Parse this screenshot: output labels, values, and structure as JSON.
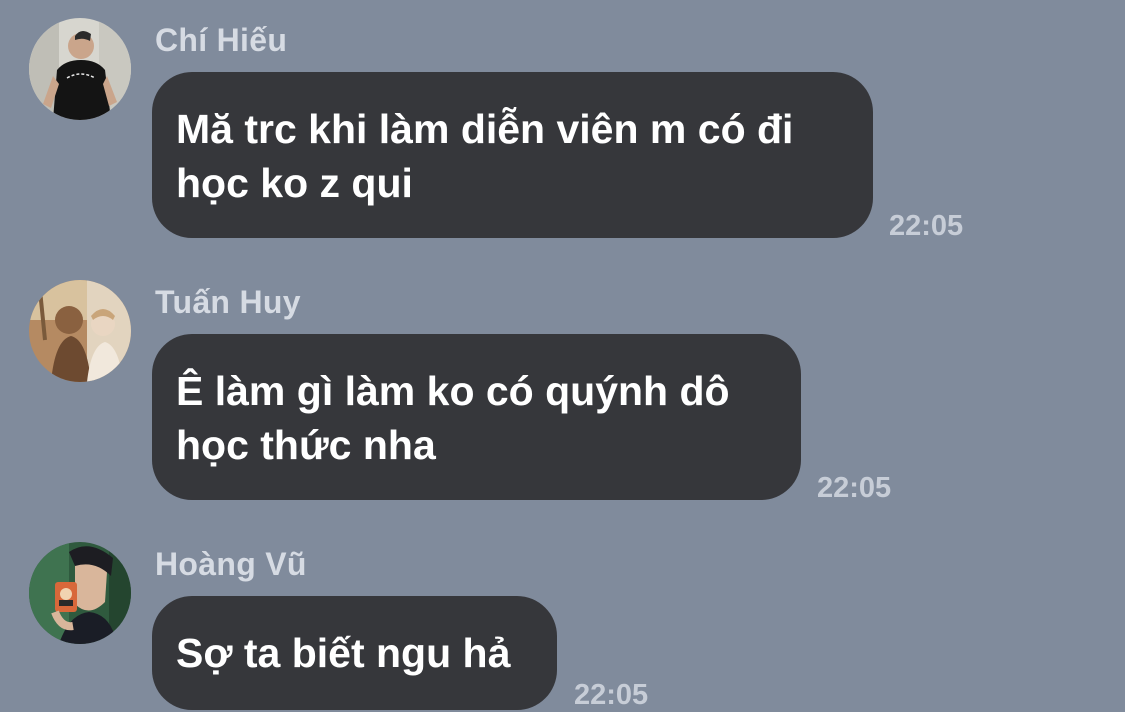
{
  "messages": [
    {
      "sender": "Chí Hiếu",
      "text_lines": [
        "Mă trc khi làm diễn viên m có đi",
        "học ko z qui"
      ],
      "time": "22:05",
      "avatar_icon": "person-black-tshirt-photo"
    },
    {
      "sender": "Tuấn Huy",
      "text_lines": [
        "Ê làm gì làm ko có quýnh dô",
        "học thức nha"
      ],
      "time": "22:05",
      "avatar_icon": "two-people-photo"
    },
    {
      "sender": "Hoàng Vũ",
      "text_lines": [
        "Sợ ta biết ngu hả"
      ],
      "time": "22:05",
      "avatar_icon": "person-with-camera-photo"
    }
  ],
  "colors": {
    "background": "#808b9c",
    "bubble": "#36373b",
    "text": "#ffffff",
    "sender": "#d6dbe3",
    "time": "#c7cdd7"
  }
}
